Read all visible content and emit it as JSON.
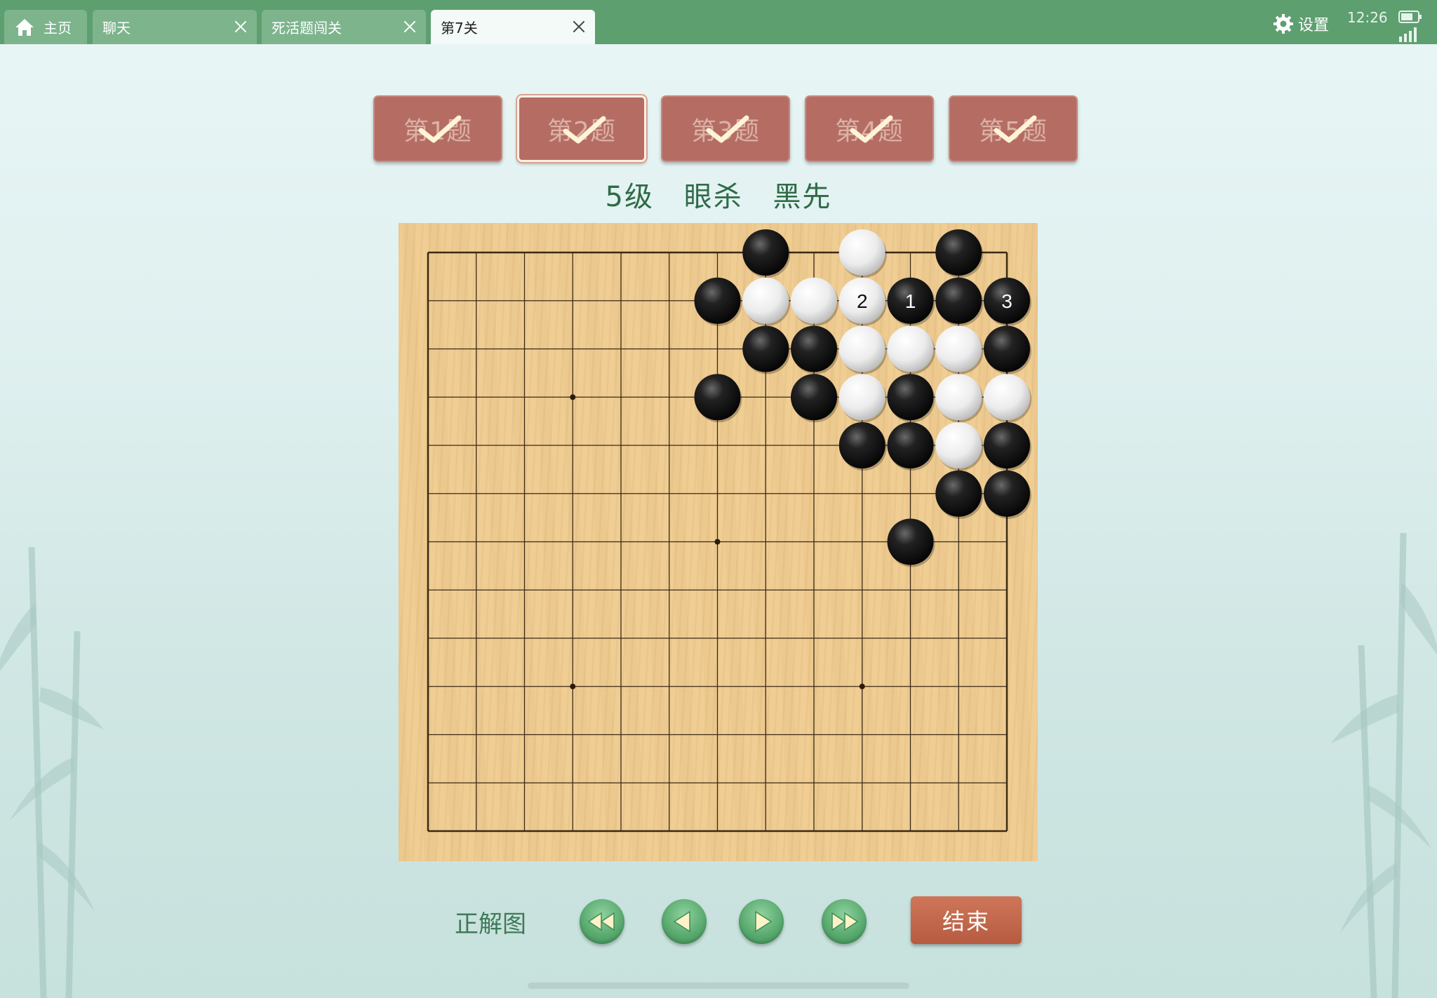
{
  "tabs": [
    {
      "label": "主页",
      "icon": "home-icon",
      "active": false,
      "closable": false
    },
    {
      "label": "聊天",
      "active": false,
      "closable": true
    },
    {
      "label": "死活题闯关",
      "active": false,
      "closable": true
    },
    {
      "label": "第7关",
      "active": true,
      "closable": true
    }
  ],
  "status": {
    "settings_label": "设置",
    "time": "12:26"
  },
  "questions": [
    {
      "label": "第1题",
      "solved": true,
      "selected": false
    },
    {
      "label": "第2题",
      "solved": true,
      "selected": true
    },
    {
      "label": "第3题",
      "solved": true,
      "selected": false
    },
    {
      "label": "第4题",
      "solved": true,
      "selected": false
    },
    {
      "label": "第5题",
      "solved": true,
      "selected": false
    }
  ],
  "problem": {
    "level": "5级",
    "type": "眼杀",
    "to_play": "黑先"
  },
  "board": {
    "size": 13,
    "star_points": [
      [
        3,
        3
      ],
      [
        3,
        9
      ],
      [
        6,
        6
      ],
      [
        9,
        3
      ],
      [
        9,
        9
      ]
    ],
    "stones": [
      {
        "color": "black",
        "col": 7,
        "row": 0
      },
      {
        "color": "white",
        "col": 9,
        "row": 0
      },
      {
        "color": "black",
        "col": 11,
        "row": 0
      },
      {
        "color": "black",
        "col": 6,
        "row": 1
      },
      {
        "color": "white",
        "col": 7,
        "row": 1
      },
      {
        "color": "white",
        "col": 8,
        "row": 1
      },
      {
        "color": "white",
        "col": 9,
        "row": 1,
        "label": "2"
      },
      {
        "color": "black",
        "col": 10,
        "row": 1,
        "label": "1"
      },
      {
        "color": "black",
        "col": 11,
        "row": 1
      },
      {
        "color": "black",
        "col": 12,
        "row": 1,
        "label": "3"
      },
      {
        "color": "black",
        "col": 7,
        "row": 2
      },
      {
        "color": "black",
        "col": 8,
        "row": 2
      },
      {
        "color": "white",
        "col": 9,
        "row": 2
      },
      {
        "color": "white",
        "col": 10,
        "row": 2
      },
      {
        "color": "white",
        "col": 11,
        "row": 2
      },
      {
        "color": "black",
        "col": 12,
        "row": 2
      },
      {
        "color": "black",
        "col": 6,
        "row": 3
      },
      {
        "color": "black",
        "col": 8,
        "row": 3
      },
      {
        "color": "white",
        "col": 9,
        "row": 3
      },
      {
        "color": "black",
        "col": 10,
        "row": 3
      },
      {
        "color": "white",
        "col": 11,
        "row": 3
      },
      {
        "color": "white",
        "col": 12,
        "row": 3
      },
      {
        "color": "black",
        "col": 9,
        "row": 4
      },
      {
        "color": "black",
        "col": 10,
        "row": 4
      },
      {
        "color": "white",
        "col": 11,
        "row": 4
      },
      {
        "color": "black",
        "col": 12,
        "row": 4
      },
      {
        "color": "black",
        "col": 11,
        "row": 5
      },
      {
        "color": "black",
        "col": 12,
        "row": 5
      },
      {
        "color": "black",
        "col": 10,
        "row": 6
      }
    ]
  },
  "controls": {
    "answer_label": "正解图",
    "buttons": [
      "first-move",
      "previous-move",
      "next-move",
      "last-move"
    ],
    "end_label": "结束"
  }
}
